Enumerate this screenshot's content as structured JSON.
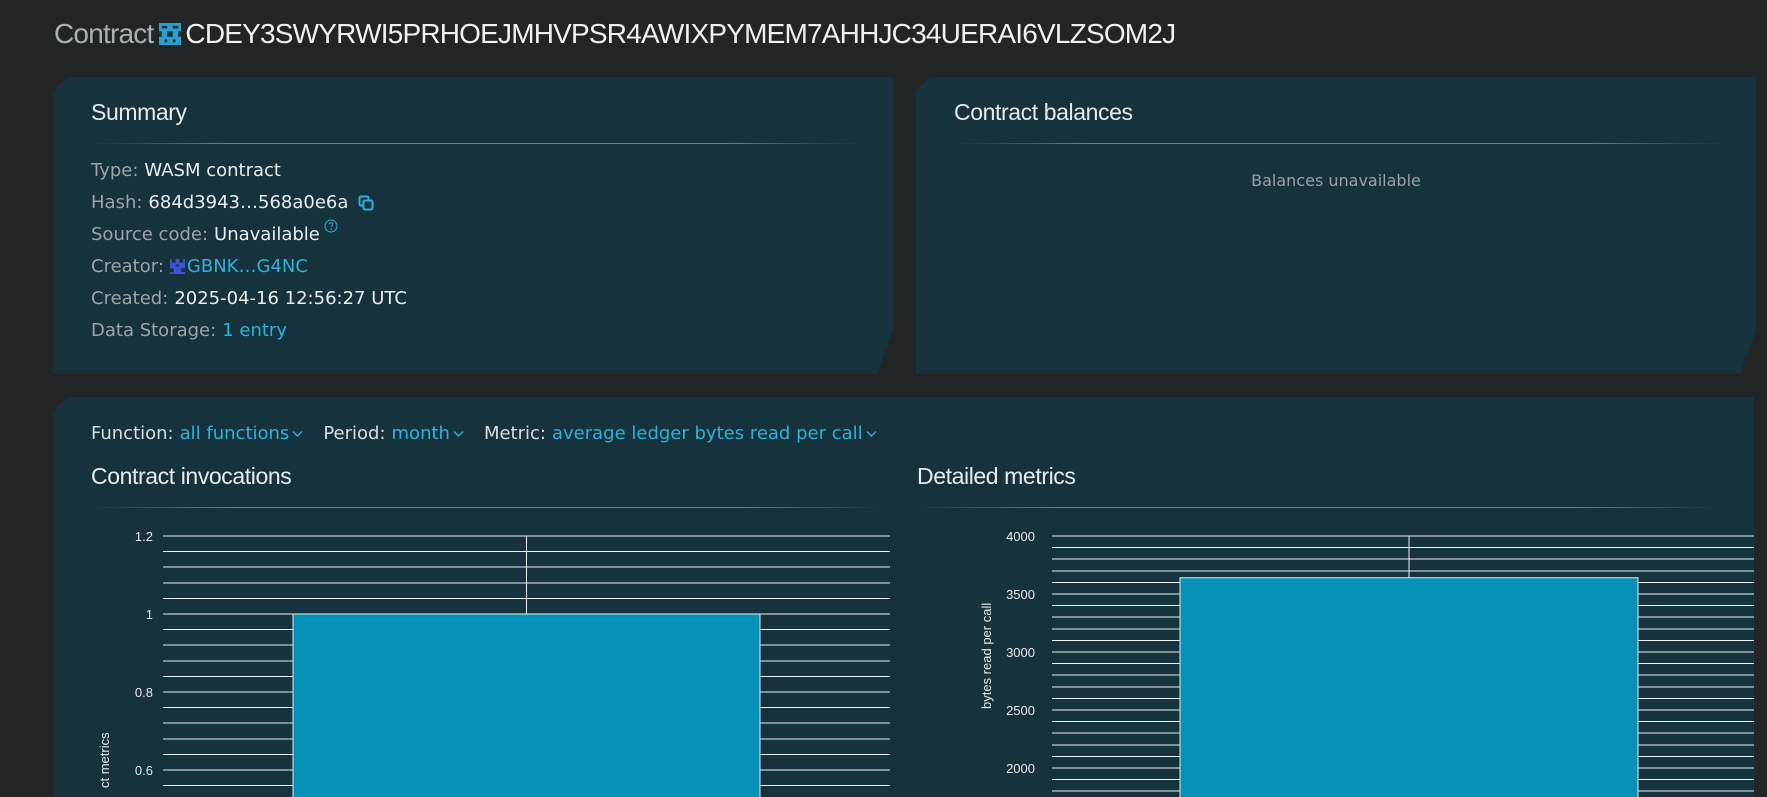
{
  "header": {
    "label": "Contract",
    "contract_id": "CDEY3SWYRWI5PRHOEJMHVPSR4AWIXPYMEM7AHHJC34UERAI6VLZSOM2J",
    "icon": "contract-identicon"
  },
  "summary": {
    "title": "Summary",
    "type_label": "Type:",
    "type_value": "WASM contract",
    "hash_label": "Hash:",
    "hash_value": "684d3943…568a0e6a",
    "source_label": "Source code:",
    "source_value": "Unavailable",
    "creator_label": "Creator:",
    "creator_value": "GBNK…G4NC",
    "created_label": "Created:",
    "created_value": "2025-04-16 12:56:27 UTC",
    "storage_label": "Data Storage:",
    "storage_value": "1 entry"
  },
  "balances": {
    "title": "Contract balances",
    "empty_text": "Balances unavailable"
  },
  "filters": {
    "function_label": "Function:",
    "function_value": "all functions",
    "period_label": "Period:",
    "period_value": "month",
    "metric_label": "Metric:",
    "metric_value": "average ledger bytes read per call"
  },
  "invocations": {
    "title": "Contract invocations"
  },
  "detailed": {
    "title": "Detailed metrics"
  },
  "colors": {
    "accent": "#2cb3d9",
    "bar": "#0591b8",
    "panel": "#16323c",
    "background": "#212526"
  },
  "chart_data": [
    {
      "type": "bar",
      "ylabel": "ct metrics",
      "ylim": [
        0.6,
        1.2
      ],
      "yticks": [
        "1.2",
        "1",
        "0.8",
        "0.6"
      ],
      "values": [
        1
      ],
      "grid": true
    },
    {
      "type": "bar",
      "ylabel": "bytes read per call",
      "ylim": [
        2000,
        4000
      ],
      "yticks": [
        "4000",
        "3500",
        "3000",
        "2500",
        "2000"
      ],
      "values": [
        3640
      ],
      "grid": true
    }
  ]
}
